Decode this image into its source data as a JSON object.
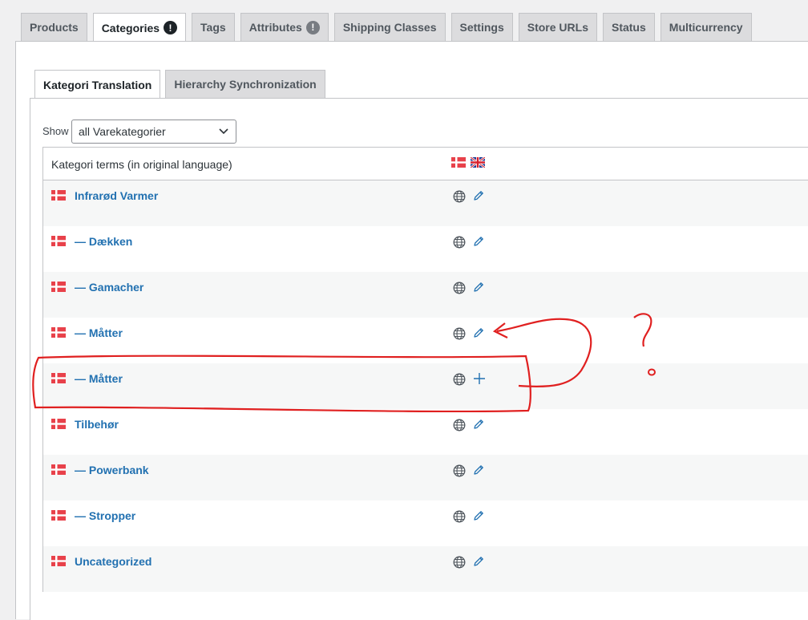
{
  "top_tabs": [
    {
      "label": "Products",
      "badge": ""
    },
    {
      "label": "Categories",
      "badge": "!"
    },
    {
      "label": "Tags",
      "badge": ""
    },
    {
      "label": "Attributes",
      "badge": "!"
    },
    {
      "label": "Shipping Classes",
      "badge": ""
    },
    {
      "label": "Settings",
      "badge": ""
    },
    {
      "label": "Store URLs",
      "badge": ""
    },
    {
      "label": "Status",
      "badge": ""
    },
    {
      "label": "Multicurrency",
      "badge": ""
    }
  ],
  "top_tabs_active": "Categories",
  "sub_tabs": [
    {
      "label": "Kategori Translation"
    },
    {
      "label": "Hierarchy Synchronization"
    }
  ],
  "sub_tabs_active": "Kategori Translation",
  "filter": {
    "label": "Show",
    "selected": "all Varekategorier"
  },
  "table": {
    "header": "Kategori terms (in original language)",
    "languages": [
      "danish-flag-icon",
      "uk-flag-icon"
    ],
    "rows": [
      {
        "name": "Infrarød Varmer",
        "action": "edit"
      },
      {
        "name": "— Dækken",
        "action": "edit"
      },
      {
        "name": "— Gamacher",
        "action": "edit"
      },
      {
        "name": "— Måtter",
        "action": "edit"
      },
      {
        "name": "— Måtter",
        "action": "add"
      },
      {
        "name": "Tilbehør",
        "action": "edit"
      },
      {
        "name": "— Powerbank",
        "action": "edit"
      },
      {
        "name": "— Stropper",
        "action": "edit"
      },
      {
        "name": "Uncategorized",
        "action": "edit"
      }
    ]
  },
  "annotation": {
    "mark": "?",
    "color": "#e02020"
  },
  "colors": {
    "link": "#2271b1",
    "danish_red": "#e8414a",
    "tab_bg": "#dcdcde"
  }
}
